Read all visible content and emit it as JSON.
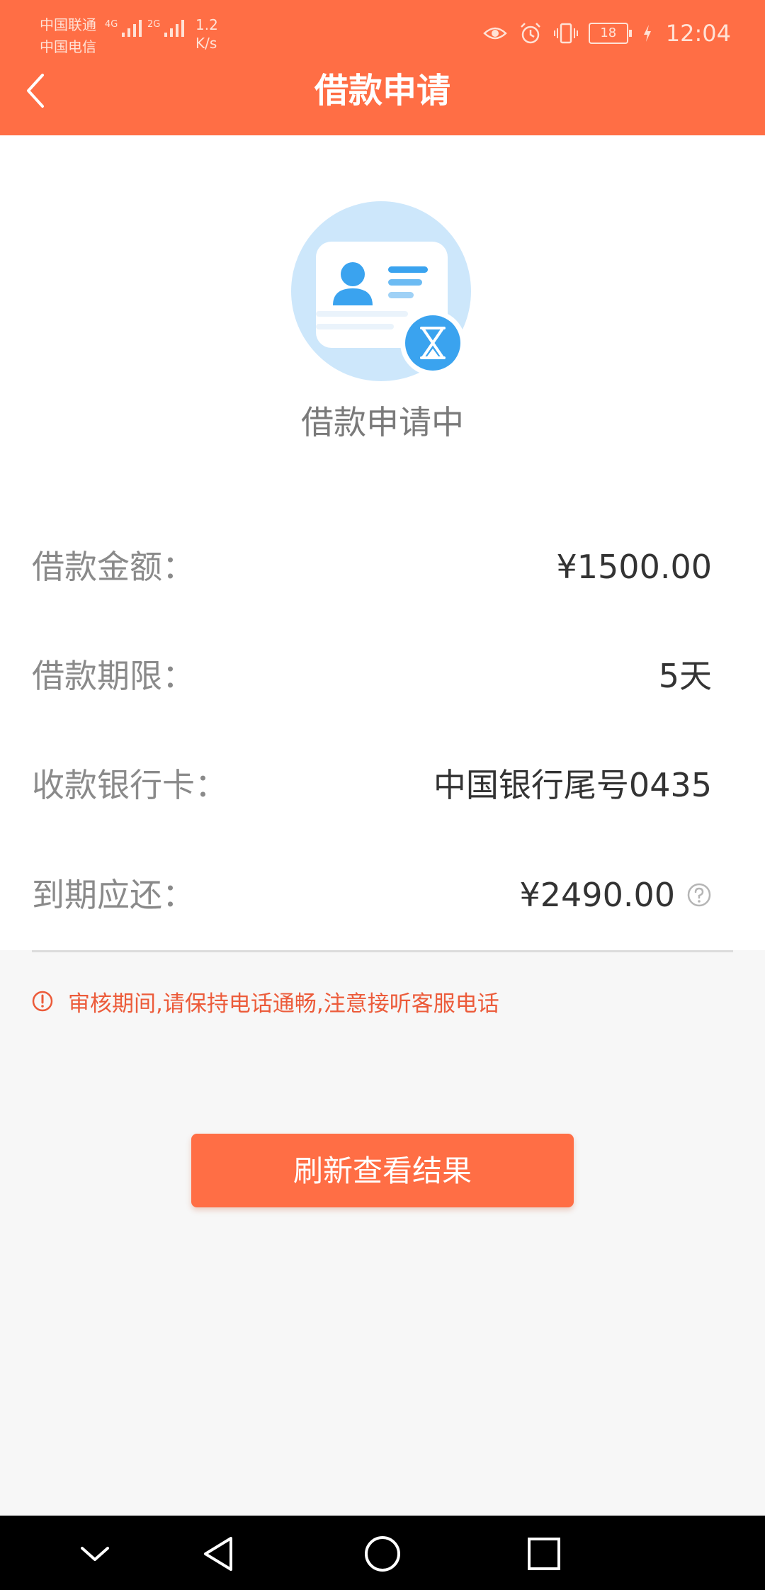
{
  "status_bar": {
    "carrier_1": "中国联通",
    "carrier_2": "中国电信",
    "signal_1_tag": "4G",
    "signal_2_tag": "2G",
    "net_speed_value": "1.2",
    "net_speed_unit": "K/s",
    "battery_level": "18",
    "time": "12:04"
  },
  "nav": {
    "title": "借款申请"
  },
  "status": {
    "title": "借款申请中"
  },
  "details": [
    {
      "label": "借款金额：",
      "value": "¥1500.00"
    },
    {
      "label": "借款期限：",
      "value": "5天"
    },
    {
      "label": "收款银行卡：",
      "value": "中国银行尾号0435"
    },
    {
      "label": "到期应还：",
      "value": "¥2490.00"
    }
  ],
  "notice": {
    "text": "审核期间,请保持电话通畅,注意接听客服电话"
  },
  "actions": {
    "refresh_label": "刷新查看结果"
  },
  "colors": {
    "primary": "#ff6e45",
    "notice": "#ec5b3a",
    "avatar_bg": "#cde7fb",
    "avatar_accent": "#3aa3ef"
  }
}
